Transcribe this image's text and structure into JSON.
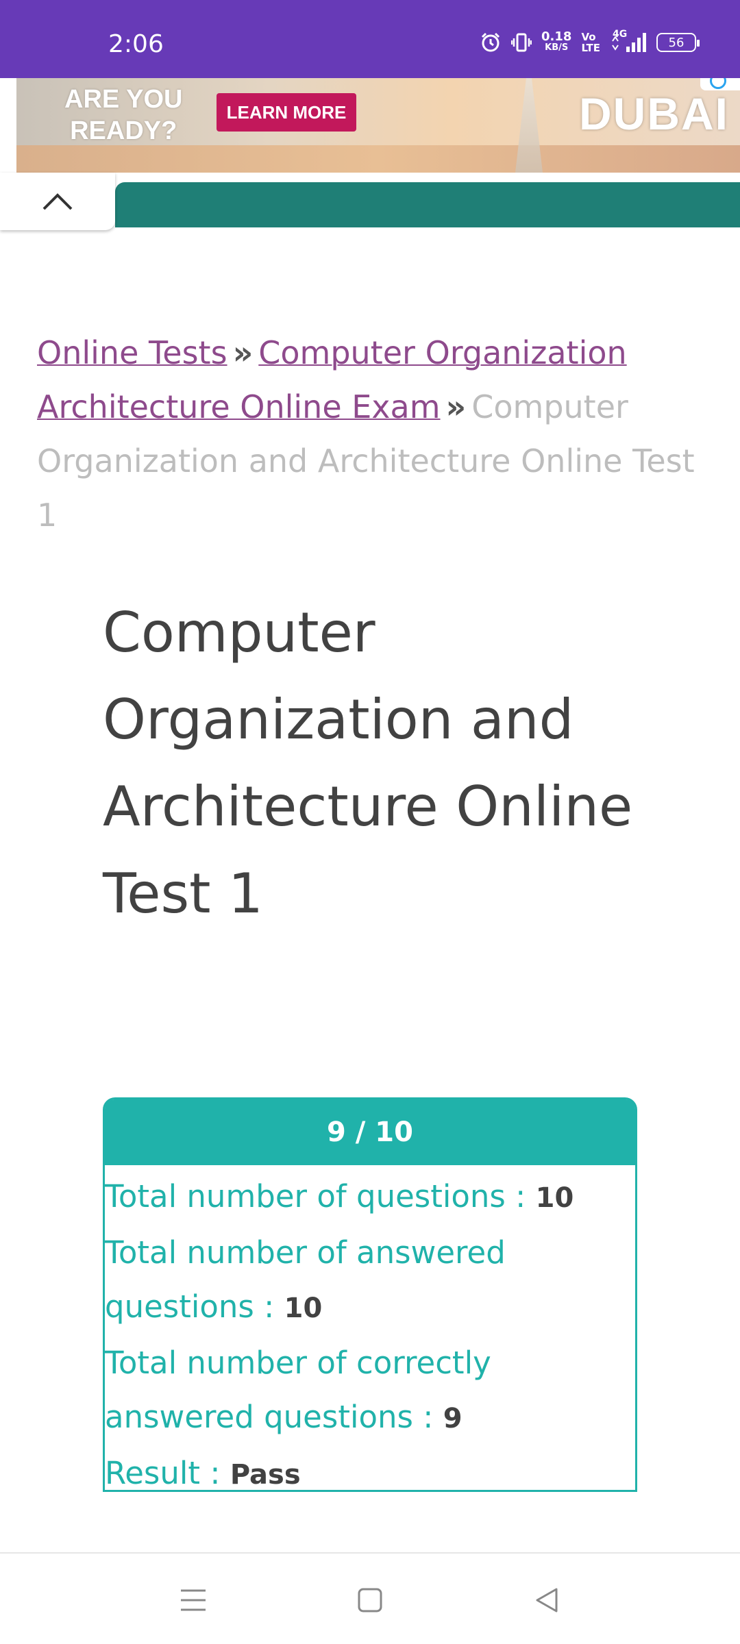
{
  "status_bar": {
    "time": "2:06",
    "net_speed_value": "0.18",
    "net_speed_unit": "KB/S",
    "volte_top": "Vo",
    "volte_bottom": "LTE",
    "network_type": "4G",
    "battery_level": "56",
    "icons": [
      "alarm-icon",
      "vibrate-icon",
      "signal-icon",
      "battery-icon"
    ]
  },
  "ad": {
    "headline_line1": "ARE YOU",
    "headline_line2": "READY?",
    "cta_label": "LEARN MORE",
    "brand": "DUBAI"
  },
  "breadcrumb": {
    "items": [
      {
        "label": "Online Tests",
        "link": true
      },
      {
        "label": "Computer Organization Architecture Online Exam",
        "link": true
      },
      {
        "label": "Computer Organization and Architecture Online Test 1",
        "link": false
      }
    ],
    "separator": "»"
  },
  "page": {
    "title": "Computer Organization and Architecture Online Test 1"
  },
  "result": {
    "score": "9 / 10",
    "rows": [
      {
        "label": "Total number of questions : ",
        "value": "10"
      },
      {
        "label": "Total number of answered questions : ",
        "value": "10"
      },
      {
        "label": "Total number of correctly answered questions : ",
        "value": "9"
      },
      {
        "label": "Result : ",
        "value": "Pass"
      }
    ]
  },
  "colors": {
    "status_bar": "#673ab7",
    "teal": "#20b2aa",
    "teal_dark": "#1f7f76",
    "link": "#8e4a8c"
  },
  "nav_bar": {
    "icons": [
      "menu-icon",
      "home-square-icon",
      "back-triangle-icon"
    ]
  }
}
